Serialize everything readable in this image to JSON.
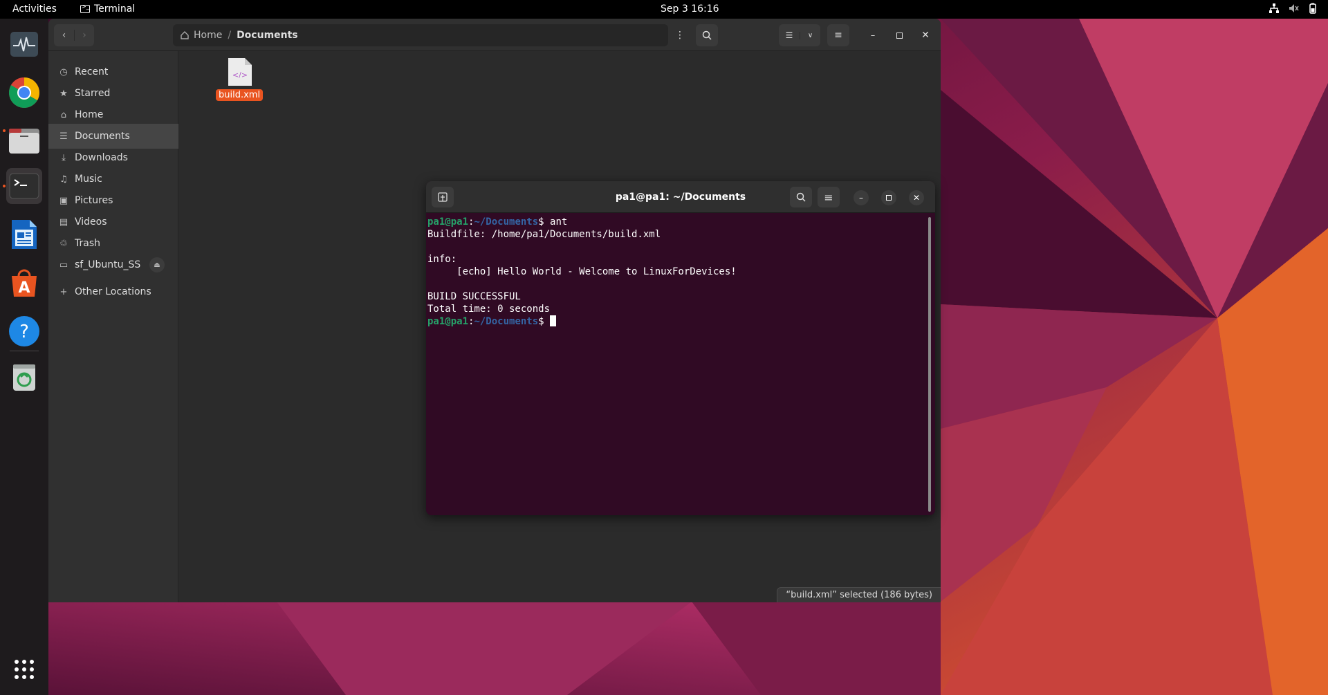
{
  "topbar": {
    "activities": "Activities",
    "app_name": "Terminal",
    "clock": "Sep 3  16:16",
    "tray_icons": [
      "network-icon",
      "volume-muted-icon",
      "battery-icon"
    ]
  },
  "dock": {
    "items": [
      {
        "name": "system-monitor",
        "running": false,
        "active": false
      },
      {
        "name": "chrome",
        "running": false,
        "active": false
      },
      {
        "name": "files",
        "running": true,
        "active": false
      },
      {
        "name": "terminal",
        "running": true,
        "active": true
      },
      {
        "name": "libreoffice-writer",
        "running": false,
        "active": false
      },
      {
        "name": "app-center",
        "running": false,
        "active": false
      },
      {
        "name": "help",
        "running": false,
        "active": false
      },
      {
        "name": "trash",
        "running": false,
        "active": false
      }
    ],
    "show_apps": "show-apps-grid-icon"
  },
  "files": {
    "path": [
      "Home",
      "Documents"
    ],
    "sidebar": [
      {
        "label": "Recent",
        "icon": "clock-icon"
      },
      {
        "label": "Starred",
        "icon": "star-icon"
      },
      {
        "label": "Home",
        "icon": "home-icon"
      },
      {
        "label": "Documents",
        "icon": "document-icon",
        "selected": true
      },
      {
        "label": "Downloads",
        "icon": "download-icon"
      },
      {
        "label": "Music",
        "icon": "music-icon"
      },
      {
        "label": "Pictures",
        "icon": "picture-icon"
      },
      {
        "label": "Videos",
        "icon": "video-icon"
      },
      {
        "label": "Trash",
        "icon": "trash-icon"
      },
      {
        "label": "sf_Ubuntu_SS",
        "icon": "drive-icon",
        "eject": true
      },
      {
        "label": "Other Locations",
        "icon": "plus-icon"
      }
    ],
    "file": {
      "name": "build.xml",
      "icon_glyph": "</>"
    },
    "status": "“build.xml” selected  (186 bytes)"
  },
  "terminal": {
    "title": "pa1@pa1: ~/Documents",
    "lines": [
      {
        "user": "pa1@pa1",
        "path": "~/Documents",
        "cmd": " ant"
      },
      {
        "text": "Buildfile: /home/pa1/Documents/build.xml"
      },
      {
        "text": ""
      },
      {
        "text": "info:"
      },
      {
        "text": "     [echo] Hello World - Welcome to LinuxForDevices!"
      },
      {
        "text": ""
      },
      {
        "text": "BUILD SUCCESSFUL"
      },
      {
        "text": "Total time: 0 seconds"
      },
      {
        "user": "pa1@pa1",
        "path": "~/Documents",
        "cmd": " ",
        "cursor": true
      }
    ]
  },
  "colors": {
    "accent": "#e95420",
    "terminal_bg": "#300a24",
    "prompt_user": "#26a269",
    "prompt_path": "#3465a4"
  }
}
